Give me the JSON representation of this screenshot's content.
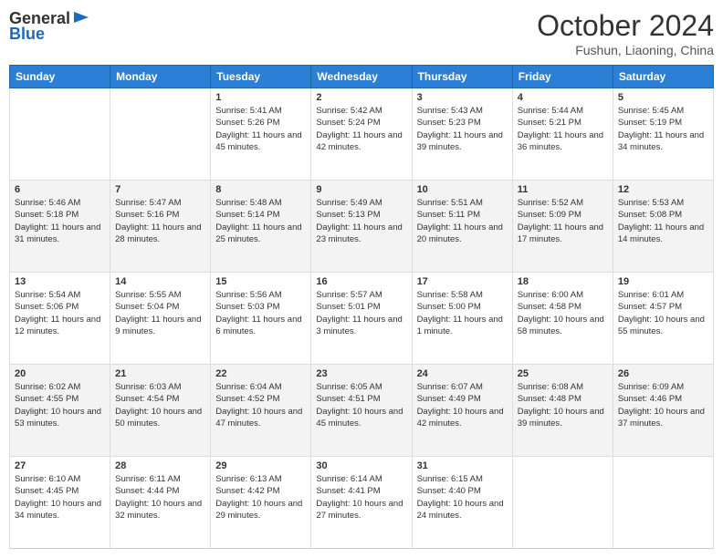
{
  "header": {
    "logo_general": "General",
    "logo_blue": "Blue",
    "month": "October 2024",
    "location": "Fushun, Liaoning, China"
  },
  "days_of_week": [
    "Sunday",
    "Monday",
    "Tuesday",
    "Wednesday",
    "Thursday",
    "Friday",
    "Saturday"
  ],
  "weeks": [
    [
      {
        "day": "",
        "info": ""
      },
      {
        "day": "",
        "info": ""
      },
      {
        "day": "1",
        "info": "Sunrise: 5:41 AM\nSunset: 5:26 PM\nDaylight: 11 hours and 45 minutes."
      },
      {
        "day": "2",
        "info": "Sunrise: 5:42 AM\nSunset: 5:24 PM\nDaylight: 11 hours and 42 minutes."
      },
      {
        "day": "3",
        "info": "Sunrise: 5:43 AM\nSunset: 5:23 PM\nDaylight: 11 hours and 39 minutes."
      },
      {
        "day": "4",
        "info": "Sunrise: 5:44 AM\nSunset: 5:21 PM\nDaylight: 11 hours and 36 minutes."
      },
      {
        "day": "5",
        "info": "Sunrise: 5:45 AM\nSunset: 5:19 PM\nDaylight: 11 hours and 34 minutes."
      }
    ],
    [
      {
        "day": "6",
        "info": "Sunrise: 5:46 AM\nSunset: 5:18 PM\nDaylight: 11 hours and 31 minutes."
      },
      {
        "day": "7",
        "info": "Sunrise: 5:47 AM\nSunset: 5:16 PM\nDaylight: 11 hours and 28 minutes."
      },
      {
        "day": "8",
        "info": "Sunrise: 5:48 AM\nSunset: 5:14 PM\nDaylight: 11 hours and 25 minutes."
      },
      {
        "day": "9",
        "info": "Sunrise: 5:49 AM\nSunset: 5:13 PM\nDaylight: 11 hours and 23 minutes."
      },
      {
        "day": "10",
        "info": "Sunrise: 5:51 AM\nSunset: 5:11 PM\nDaylight: 11 hours and 20 minutes."
      },
      {
        "day": "11",
        "info": "Sunrise: 5:52 AM\nSunset: 5:09 PM\nDaylight: 11 hours and 17 minutes."
      },
      {
        "day": "12",
        "info": "Sunrise: 5:53 AM\nSunset: 5:08 PM\nDaylight: 11 hours and 14 minutes."
      }
    ],
    [
      {
        "day": "13",
        "info": "Sunrise: 5:54 AM\nSunset: 5:06 PM\nDaylight: 11 hours and 12 minutes."
      },
      {
        "day": "14",
        "info": "Sunrise: 5:55 AM\nSunset: 5:04 PM\nDaylight: 11 hours and 9 minutes."
      },
      {
        "day": "15",
        "info": "Sunrise: 5:56 AM\nSunset: 5:03 PM\nDaylight: 11 hours and 6 minutes."
      },
      {
        "day": "16",
        "info": "Sunrise: 5:57 AM\nSunset: 5:01 PM\nDaylight: 11 hours and 3 minutes."
      },
      {
        "day": "17",
        "info": "Sunrise: 5:58 AM\nSunset: 5:00 PM\nDaylight: 11 hours and 1 minute."
      },
      {
        "day": "18",
        "info": "Sunrise: 6:00 AM\nSunset: 4:58 PM\nDaylight: 10 hours and 58 minutes."
      },
      {
        "day": "19",
        "info": "Sunrise: 6:01 AM\nSunset: 4:57 PM\nDaylight: 10 hours and 55 minutes."
      }
    ],
    [
      {
        "day": "20",
        "info": "Sunrise: 6:02 AM\nSunset: 4:55 PM\nDaylight: 10 hours and 53 minutes."
      },
      {
        "day": "21",
        "info": "Sunrise: 6:03 AM\nSunset: 4:54 PM\nDaylight: 10 hours and 50 minutes."
      },
      {
        "day": "22",
        "info": "Sunrise: 6:04 AM\nSunset: 4:52 PM\nDaylight: 10 hours and 47 minutes."
      },
      {
        "day": "23",
        "info": "Sunrise: 6:05 AM\nSunset: 4:51 PM\nDaylight: 10 hours and 45 minutes."
      },
      {
        "day": "24",
        "info": "Sunrise: 6:07 AM\nSunset: 4:49 PM\nDaylight: 10 hours and 42 minutes."
      },
      {
        "day": "25",
        "info": "Sunrise: 6:08 AM\nSunset: 4:48 PM\nDaylight: 10 hours and 39 minutes."
      },
      {
        "day": "26",
        "info": "Sunrise: 6:09 AM\nSunset: 4:46 PM\nDaylight: 10 hours and 37 minutes."
      }
    ],
    [
      {
        "day": "27",
        "info": "Sunrise: 6:10 AM\nSunset: 4:45 PM\nDaylight: 10 hours and 34 minutes."
      },
      {
        "day": "28",
        "info": "Sunrise: 6:11 AM\nSunset: 4:44 PM\nDaylight: 10 hours and 32 minutes."
      },
      {
        "day": "29",
        "info": "Sunrise: 6:13 AM\nSunset: 4:42 PM\nDaylight: 10 hours and 29 minutes."
      },
      {
        "day": "30",
        "info": "Sunrise: 6:14 AM\nSunset: 4:41 PM\nDaylight: 10 hours and 27 minutes."
      },
      {
        "day": "31",
        "info": "Sunrise: 6:15 AM\nSunset: 4:40 PM\nDaylight: 10 hours and 24 minutes."
      },
      {
        "day": "",
        "info": ""
      },
      {
        "day": "",
        "info": ""
      }
    ]
  ]
}
